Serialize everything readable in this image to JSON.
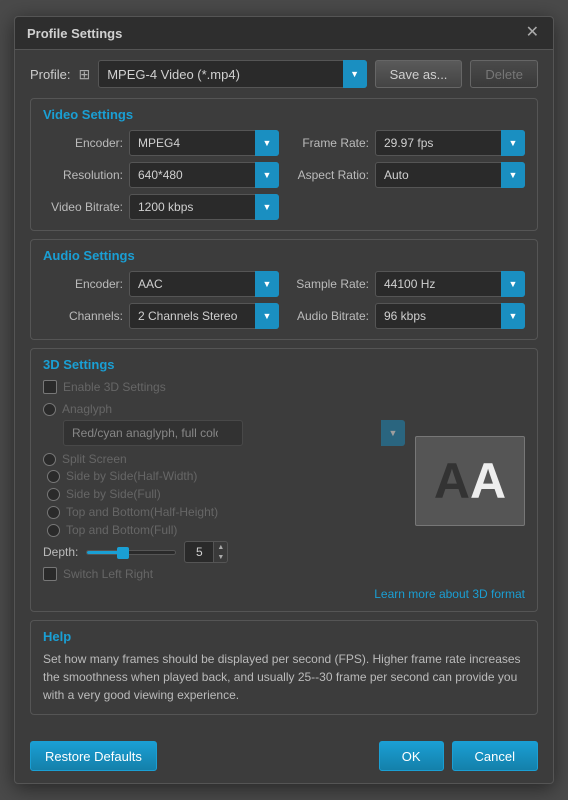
{
  "dialog": {
    "title": "Profile Settings"
  },
  "profile": {
    "label": "Profile:",
    "value": "MPEG-4 Video (*.mp4)",
    "save_as_label": "Save as...",
    "delete_label": "Delete"
  },
  "video_settings": {
    "section_title": "Video Settings",
    "encoder_label": "Encoder:",
    "encoder_value": "MPEG4",
    "resolution_label": "Resolution:",
    "resolution_value": "640*480",
    "bitrate_label": "Video Bitrate:",
    "bitrate_value": "1200 kbps",
    "frame_rate_label": "Frame Rate:",
    "frame_rate_value": "29.97 fps",
    "aspect_ratio_label": "Aspect Ratio:",
    "aspect_ratio_value": "Auto"
  },
  "audio_settings": {
    "section_title": "Audio Settings",
    "encoder_label": "Encoder:",
    "encoder_value": "AAC",
    "channels_label": "Channels:",
    "channels_value": "2 Channels Stereo",
    "sample_rate_label": "Sample Rate:",
    "sample_rate_value": "44100 Hz",
    "audio_bitrate_label": "Audio Bitrate:",
    "audio_bitrate_value": "96 kbps"
  },
  "three_d_settings": {
    "section_title": "3D Settings",
    "enable_label": "Enable 3D Settings",
    "anaglyph_label": "Anaglyph",
    "anaglyph_option": "Red/cyan anaglyph, full color",
    "split_screen_label": "Split Screen",
    "side_by_side_half_label": "Side by Side(Half-Width)",
    "side_by_side_full_label": "Side by Side(Full)",
    "top_bottom_half_label": "Top and Bottom(Half-Height)",
    "top_bottom_full_label": "Top and Bottom(Full)",
    "depth_label": "Depth:",
    "depth_value": "5",
    "switch_label": "Switch Left Right",
    "learn_link": "Learn more about 3D format",
    "aa_preview_left": "A",
    "aa_preview_right": "A"
  },
  "help": {
    "section_title": "Help",
    "text": "Set how many frames should be displayed per second (FPS). Higher frame rate increases the smoothness when played back, and usually 25--30 frame per second can provide you with a very good viewing experience."
  },
  "footer": {
    "restore_label": "Restore Defaults",
    "ok_label": "OK",
    "cancel_label": "Cancel"
  }
}
